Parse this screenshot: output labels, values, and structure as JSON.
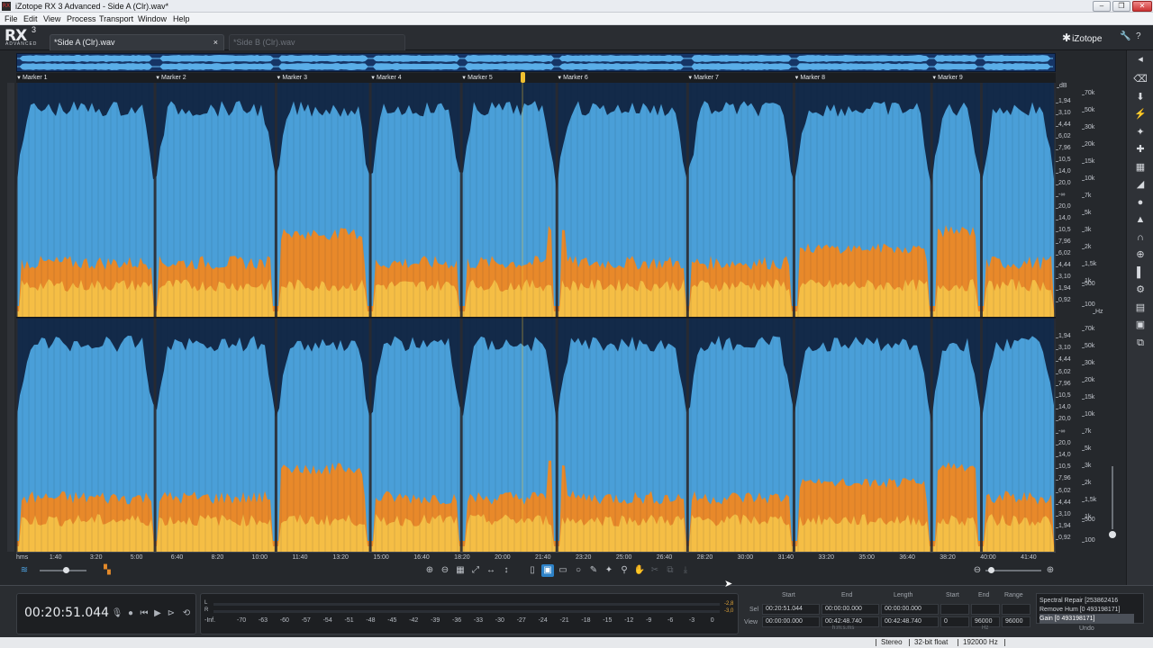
{
  "window": {
    "title": "iZotope RX 3 Advanced - Side A (Clr).wav*",
    "app_icon": "rx-app-icon",
    "min_glyph": "–",
    "max_glyph": "❐",
    "close_glyph": "✕"
  },
  "menu": [
    "File",
    "Edit",
    "View",
    "Process",
    "Transport",
    "Window",
    "Help"
  ],
  "header": {
    "logo_rx": "RX",
    "logo_version": "3",
    "logo_edition": "ADVANCED",
    "tabs": [
      {
        "label": "*Side A (Clr).wav",
        "active": true,
        "close": "×"
      },
      {
        "label": "*Side B (Clr).wav",
        "active": false
      }
    ],
    "brand": "iZotope",
    "brand_glyph": "✱",
    "icons": [
      "wrench-icon",
      "help-icon"
    ],
    "icon_glyphs": [
      "🔧",
      "?"
    ]
  },
  "markers": [
    {
      "label": "Marker 1",
      "time": 0
    },
    {
      "label": "Marker 2",
      "time": 343
    },
    {
      "label": "Marker 3",
      "time": 642
    },
    {
      "label": "Marker 4",
      "time": 875
    },
    {
      "label": "Marker 5",
      "time": 1100
    },
    {
      "label": "Marker 6",
      "time": 1336
    },
    {
      "label": "Marker 7",
      "time": 1659
    },
    {
      "label": "Marker 8",
      "time": 1922
    },
    {
      "label": "Marker 9",
      "time": 2262
    }
  ],
  "spectrogram": {
    "duration_seconds": 2568.74,
    "playhead_seconds": 1251.044,
    "silence_points": [
      0,
      343,
      642,
      875,
      1100,
      1336,
      1659,
      1922,
      2262,
      2385,
      2568
    ],
    "colors": {
      "blue": "#4a9fd8",
      "navy": "#0e1f3d",
      "orange": "#e8892a",
      "yellow": "#f7c84a",
      "gap": "#2a2a30"
    }
  },
  "db_scale": [
    "dB",
    "1,94",
    "3,10",
    "4,44",
    "6,02",
    "7,96",
    "10,5",
    "14,0",
    "20,0",
    "-∞",
    "20,0",
    "14,0",
    "10,5",
    "7,96",
    "6,02",
    "4,44",
    "3,10",
    "1,94",
    "0,92"
  ],
  "db_scale_2": [
    "1,94",
    "3,10",
    "4,44",
    "6,02",
    "7,96",
    "10,5",
    "14,0",
    "20,0",
    "-∞",
    "20,0",
    "14,0",
    "10,5",
    "7,96",
    "6,02",
    "4,44",
    "3,10",
    "1,94",
    "0,92"
  ],
  "hz_scale": [
    "70k",
    "50k",
    "30k",
    "20k",
    "15k",
    "10k",
    "7k",
    "5k",
    "3k",
    "2k",
    "1,5k",
    "1k",
    "500",
    "100"
  ],
  "hz_unit": "Hz",
  "time_ruler": [
    "hms",
    "1:40",
    "3:20",
    "5:00",
    "6:40",
    "8:20",
    "10:00",
    "11:40",
    "13:20",
    "15:00",
    "16:40",
    "18:20",
    "20:00",
    "21:40",
    "23:20",
    "25:00",
    "26:40",
    "28:20",
    "30:00",
    "31:40",
    "33:20",
    "35:00",
    "36:40",
    "38:20",
    "40:00",
    "41:40"
  ],
  "toolbar": {
    "zoom_tools": [
      "zoom-in-icon",
      "zoom-out-icon",
      "zoom-selection-icon",
      "zoom-fit-icon",
      "zoom-time-icon",
      "zoom-freq-icon"
    ],
    "select_tools": [
      "time-select-icon",
      "rect-select-icon",
      "freq-select-icon",
      "lasso-icon",
      "brush-icon",
      "magic-wand-icon",
      "hand-icon"
    ],
    "glyphs": {
      "zoom": [
        "⊕",
        "⊖",
        "▦",
        "⤢",
        "↔",
        "↕"
      ],
      "select": [
        "▯",
        "▣",
        "▭",
        "○",
        "✎",
        "✦",
        "⚲",
        "✋",
        "✂",
        "⧉",
        "⤓"
      ]
    },
    "waveform_glyph": "≋",
    "spectro_glyph": "▚",
    "zoom_out_glyph": "⊖",
    "zoom_in_glyph": "⊕",
    "spectrogram_opacity": 0.55,
    "horizontal_zoom": 0.1
  },
  "rail": {
    "icons": [
      "arrow-left-icon",
      "eraser-icon",
      "declip-icon",
      "decrackle-icon",
      "denoise-icon",
      "dehum-icon",
      "eq-icon",
      "spectral-repair-icon",
      "channel-ops-icon",
      "dither-icon",
      "gain-icon",
      "pitch-icon",
      "resample-icon",
      "batch-icon",
      "module-chain-icon",
      "plugin-icon",
      "spectrum-icon"
    ],
    "glyphs": [
      "◂",
      "⌫",
      "⬇",
      "⚡",
      "✦",
      "✚",
      "▦",
      "◢",
      "●",
      "▲",
      "∩",
      "⊕",
      "▌",
      "⚙",
      "▤",
      "▣",
      "⧉"
    ]
  },
  "transport": {
    "timecode": "00:20:51.044",
    "buttons": [
      "mic-icon",
      "record-icon",
      "rewind-icon",
      "play-icon",
      "play-selection-icon",
      "loop-icon"
    ],
    "glyphs": [
      "🎙",
      "●",
      "⏮",
      "▶",
      "⊳",
      "⟲"
    ]
  },
  "meter": {
    "channels": [
      "L",
      "R"
    ],
    "peak_l": "-2,8",
    "peak_r": "-3,0",
    "labels": [
      "-Inf.",
      "-70",
      "-63",
      "-60",
      "-57",
      "-54",
      "-51",
      "-48",
      "-45",
      "-42",
      "-39",
      "-36",
      "-33",
      "-30",
      "-27",
      "-24",
      "-21",
      "-18",
      "-15",
      "-12",
      "-9",
      "-6",
      "-3",
      "0"
    ]
  },
  "selection": {
    "headers": {
      "start": "Start",
      "end": "End",
      "length": "Length",
      "f_start": "Start",
      "f_end": "End",
      "range": "Range"
    },
    "rows": [
      {
        "label": "Sel",
        "start": "00:20:51.044",
        "end": "00:00:00.000",
        "length": "00:00:00.000",
        "f_start": "",
        "f_end": "",
        "range": ""
      },
      {
        "label": "View",
        "start": "00:00:00.000",
        "end": "00:42:48.740",
        "length": "00:42:48.740",
        "f_start": "0",
        "f_end": "96000",
        "range": "96000"
      }
    ],
    "unit_time": "h:m:s.ms",
    "unit_freq": "Hz"
  },
  "history": {
    "items": [
      "Spectral Repair [253862416",
      "Remove Hum [0 493198171]",
      "Gain [0 493198171]"
    ],
    "selected": 2,
    "label": "Undo"
  },
  "status": [
    "Stereo",
    "32-bit float",
    "192000 Hz"
  ],
  "cursor_glyph": "➤"
}
